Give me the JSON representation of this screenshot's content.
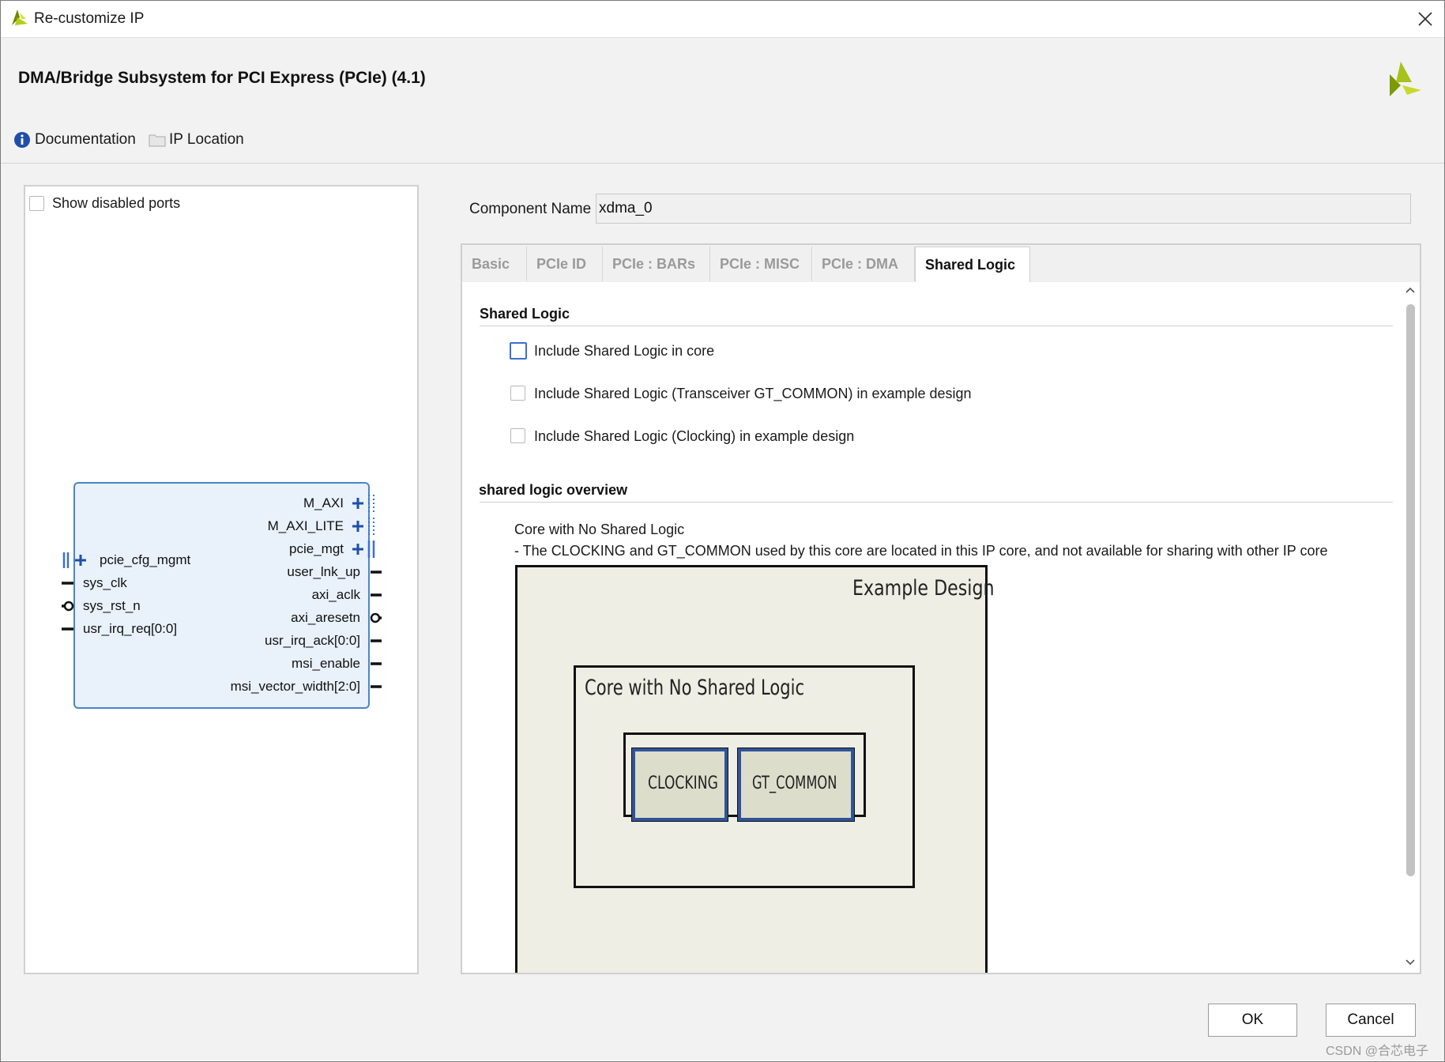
{
  "window": {
    "title": "Re-customize IP",
    "ip_name": "DMA/Bridge Subsystem for PCI Express (PCIe) (4.1)"
  },
  "links": {
    "documentation": "Documentation",
    "ip_location": "IP Location"
  },
  "left_panel": {
    "show_disabled_ports": "Show disabled ports",
    "block": {
      "left_ports": [
        "pcie_cfg_mgmt",
        "sys_clk",
        "sys_rst_n",
        "usr_irq_req[0:0]"
      ],
      "right_ports": [
        "M_AXI",
        "M_AXI_LITE",
        "pcie_mgt",
        "user_lnk_up",
        "axi_aclk",
        "axi_aresetn",
        "usr_irq_ack[0:0]",
        "msi_enable",
        "msi_vector_width[2:0]"
      ]
    }
  },
  "component": {
    "label": "Component Name",
    "value": "xdma_0"
  },
  "tabs": [
    {
      "label": "Basic",
      "active": false
    },
    {
      "label": "PCIe ID",
      "active": false
    },
    {
      "label": "PCIe : BARs",
      "active": false
    },
    {
      "label": "PCIe : MISC",
      "active": false
    },
    {
      "label": "PCIe : DMA",
      "active": false
    },
    {
      "label": "Shared Logic",
      "active": true
    }
  ],
  "shared_logic": {
    "section_title": "Shared Logic",
    "options": [
      {
        "label": "Include Shared Logic in core",
        "checked": false
      },
      {
        "label": "Include Shared Logic (Transceiver GT_COMMON) in example design",
        "checked": false
      },
      {
        "label": "Include Shared Logic (Clocking) in example design",
        "checked": false
      }
    ],
    "overview_title": "shared logic overview",
    "overview_heading": "Core with No Shared Logic",
    "overview_desc": "- The CLOCKING and GT_COMMON used by this core are located in this IP core, and not available for sharing with other IP core"
  },
  "diagram": {
    "outer_label": "Example Design",
    "inner_label": "Core with No Shared Logic",
    "box1": "CLOCKING",
    "box2": "GT_COMMON"
  },
  "buttons": {
    "ok": "OK",
    "cancel": "Cancel"
  },
  "watermark": "CSDN @合芯电子",
  "colors": {
    "accent_blue": "#3a6fd6",
    "block_fill": "#e9f1fb",
    "block_border": "#4a86c8",
    "diagram_fill": "#eeeee4",
    "diagram_inner_border": "#2f5597"
  }
}
